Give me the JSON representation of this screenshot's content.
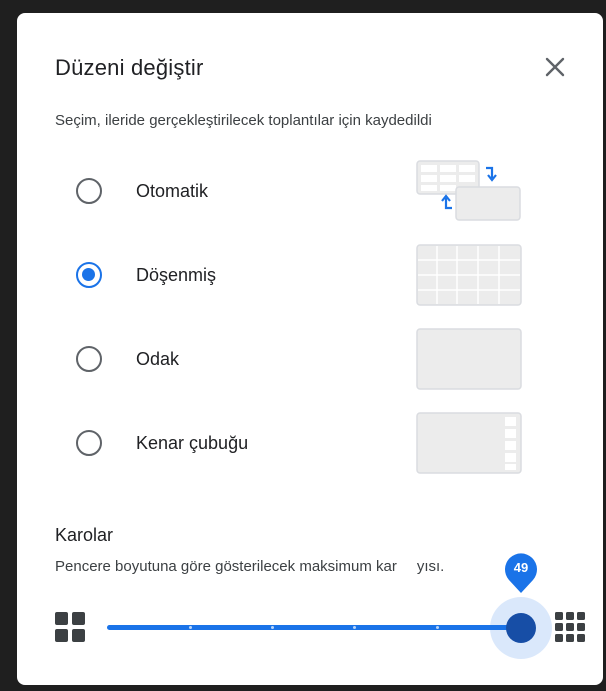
{
  "dialog": {
    "title": "Düzeni değiştir",
    "subtitle": "Seçim, ileride gerçekleştirilecek toplantılar için kaydedildi",
    "close_icon": "close-icon"
  },
  "options": [
    {
      "id": "auto",
      "label": "Otomatik",
      "checked": false,
      "preview_icon": "auto-layout-icon"
    },
    {
      "id": "tiled",
      "label": "Döşenmiş",
      "checked": true,
      "preview_icon": "tiled-layout-icon"
    },
    {
      "id": "spotlight",
      "label": "Odak",
      "checked": false,
      "preview_icon": "spotlight-layout-icon"
    },
    {
      "id": "sidebar",
      "label": "Kenar çubuğu",
      "checked": false,
      "preview_icon": "sidebar-layout-icon"
    }
  ],
  "tiles": {
    "title": "Karolar",
    "description_before": "Pencere boyutuna göre gösterilecek maksimum kar",
    "description_after": "yısı.",
    "slider_value": "49",
    "slider_fraction": 1.0,
    "min_icon": "grid-small-icon",
    "max_icon": "grid-large-icon"
  },
  "colors": {
    "accent": "#1a73e8",
    "thumb": "#174ea6",
    "preview_fill": "#ececec",
    "preview_border": "#dadce0"
  }
}
